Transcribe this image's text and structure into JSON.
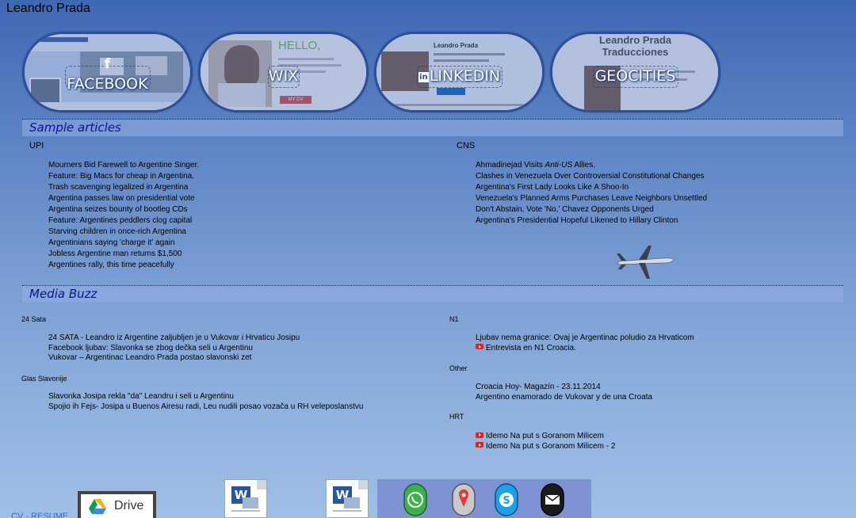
{
  "site": {
    "title": "Leandro Prada"
  },
  "social": [
    {
      "name": "FACEBOOK",
      "icon": "facebook-f-icon"
    },
    {
      "name": "WIX",
      "icon": ""
    },
    {
      "name": "LINKEDIN",
      "icon": "linkedin-in-icon"
    },
    {
      "name": "GEOCITIES",
      "icon": ""
    }
  ],
  "social_thumbs": {
    "wix_hello": "HELLO,",
    "wix_cv": "MY CV",
    "linkedin_name": "Leandro Prada",
    "geocities_line1": "Leandro Prada",
    "geocities_line2": "Traducciones"
  },
  "sample_articles": {
    "heading": "Sample articles",
    "upi": {
      "label": "UPI",
      "items": [
        "Mourners Bid Farewell to Argentine Singer.",
        "Feature: Big Macs for cheap in Argentina.",
        "Trash scavenging legalized in Argentina",
        "Argentina passes law on presidential vote",
        "Argentina seizes bounty of bootleg CDs",
        "Feature: Argentines peddlers clog capital",
        "Starving children in once-rich Argentina",
        "Argentinians saying 'charge it' again",
        "Jobless Argentine man returns $1,500",
        "Argentines rally, this time peacefully"
      ]
    },
    "cns": {
      "label": "CNS",
      "first_prefix": "Ahmadinejad Visits ",
      "first_italic": "Anti-US",
      "first_suffix": " Allies.",
      "items": [
        "Clashes in Venezuela Over Controversial Constitutional Changes",
        "Argentina's First Lady Looks Like A Shoo-In",
        "Venezuela's Planned Arms Purchases Leave Neighbors Unsettled",
        "Don't Abstain, Vote 'No,' Chavez Opponents Urged",
        "Argentina's Presidential Hopeful Likened to Hillary Clinton"
      ]
    }
  },
  "media_buzz": {
    "heading": "Media Buzz",
    "sata": {
      "label": "24 Sata",
      "items": [
        "24 SATA - Leandro iz Argentine zaljubljen je u Vukovar i Hrvaticu Josipu",
        "Facebook ljubav: Slavonka se zbog dečka seli u Argentinu",
        "Vukovar – Argentinac Leandro Prada postao slavonski zet"
      ]
    },
    "glas": {
      "label": "Glas Slavonije",
      "items": [
        "Slavonka Josipa rekla \"da\" Leandru i seli u Argentinu",
        "Spojio ih Fejs- Josipa u Buenos Airesu radi, Leu nudili posao vozača u RH veleposlanstvu"
      ]
    },
    "n1": {
      "label": "N1",
      "items": [
        "Ljubav nema granice: Ovaj je Argentinac poludio za Hrvaticom",
        "Entrevista en N1 Croacia."
      ]
    },
    "other": {
      "label": "Other",
      "items": [
        "Croacia Hoy- Magazín - 23.11.2014",
        "Argentino enamorado de Vukovar y de una Croata"
      ]
    },
    "hrt": {
      "label": "HRT",
      "items": [
        "Idemo Na put s Goranom Milicem",
        "Idemo Na put s Goranom Milicem - 2"
      ]
    }
  },
  "footer": {
    "cv_link": "CV - RESUME",
    "drive_label": "Drive",
    "contact_icons": [
      "whatsapp-icon",
      "map-pin-icon",
      "skype-icon",
      "email-icon"
    ]
  }
}
